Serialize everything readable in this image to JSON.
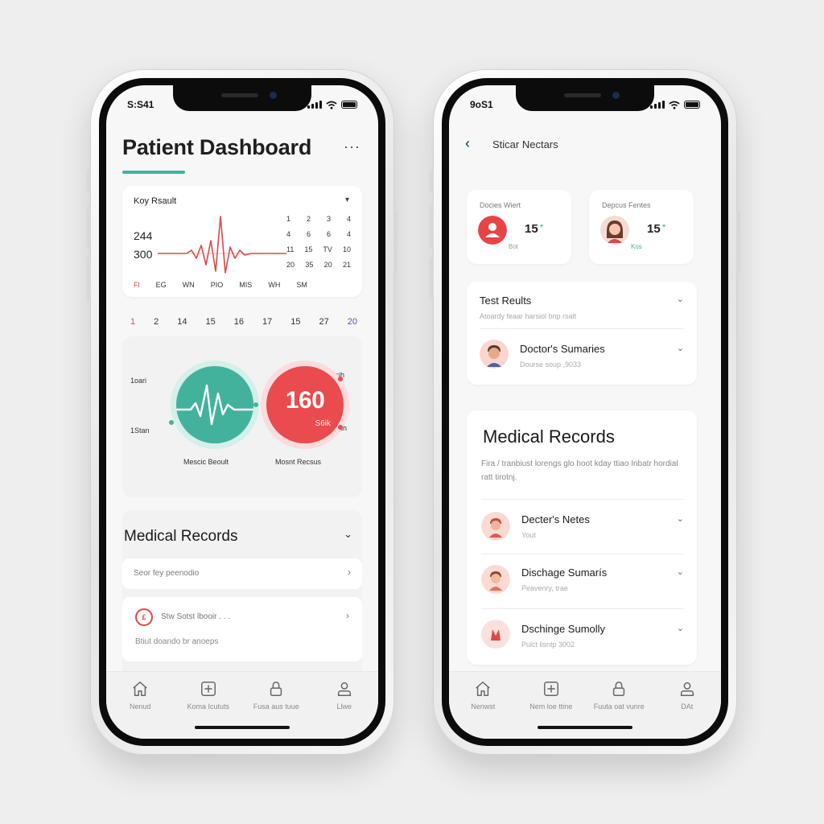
{
  "left_phone": {
    "status_time": "S:S41",
    "title": "Patient Dashboard",
    "more_label": "···",
    "vitals": {
      "label": "Koy Rsault",
      "caret": "▾",
      "value_top": "244",
      "value_bottom": "300",
      "mini_calendar": [
        [
          "1",
          "2",
          "3",
          "4"
        ],
        [
          "4",
          "6",
          "6",
          "4"
        ],
        [
          "11",
          "15",
          "TV",
          "10"
        ],
        [
          "20",
          "35",
          "20",
          "21"
        ]
      ],
      "weekdays": [
        "Fl",
        "EG",
        "WN",
        "PIO",
        "MIS",
        "WH",
        "SM"
      ]
    },
    "dates": [
      "1",
      "2",
      "14",
      "15",
      "16",
      "17",
      "15",
      "27",
      "20"
    ],
    "gauges": {
      "left_top_label": "1oari",
      "left_bottom_label": "1Stan",
      "right_top_label": "Stsih",
      "right_bottom_label": "Otsh",
      "teal_caption": "Mescic Beoult",
      "red_value": "160",
      "red_sub": "S6ik",
      "red_caption": "Mosnt Recsus",
      "teal_color": "#42b29d",
      "red_color": "#ea4b4e"
    },
    "records": {
      "title": "Medical Records",
      "chevron": "⌄",
      "search_placeholder": "Seor fey peenodio",
      "search_arrow": "›",
      "item_icon": "£",
      "item_title": "Stw Sotst lbooir . . .",
      "item_arrow": "›",
      "item_sub": "Btiut doando br anoeps"
    },
    "tabs": [
      {
        "label": "Nenud",
        "icon": "home-icon"
      },
      {
        "label": "Koma Icututs",
        "icon": "medical-kit-icon"
      },
      {
        "label": "Fusa aus tuue",
        "icon": "lock-icon"
      },
      {
        "label": "Llwe",
        "icon": "user-icon"
      }
    ]
  },
  "right_phone": {
    "status_time": "9oS1",
    "back_icon": "‹",
    "title": "Sticar Nectars",
    "doctor_cards": [
      {
        "label": "Docies Wiert",
        "value": "15",
        "mark": "+",
        "sub": "Bot",
        "avatar_color": "#e84346"
      },
      {
        "label": "Depcus Fentes",
        "value": "15",
        "mark": "+",
        "sub": "Kos",
        "avatar_color": "#e8c8b8"
      }
    ],
    "test_results": {
      "title": "Test Reults",
      "chevron": "⌄",
      "subtitle": "Atoardy feaar harsiol bnp rsalt",
      "row_title": "Doctor's Sumaries",
      "row_sub": "Dourse soup ,9033"
    },
    "medical_records": {
      "title": "Medical Records",
      "description": "Fira / tranbiust lorengs glo hoot kday ttiao Inbatr hordial ratt tirotnj.",
      "items": [
        {
          "title": "Decter's Netes",
          "sub": "Yout"
        },
        {
          "title": "Dischage Sumarís",
          "sub": "Peavenry, trae"
        },
        {
          "title": "Dschinge Sumolly",
          "sub": "Pulct lisntp 3002"
        }
      ],
      "chevron": "⌄"
    },
    "tabs": [
      {
        "label": "Nenwst",
        "icon": "home-icon"
      },
      {
        "label": "Nem loe ttine",
        "icon": "medical-kit-icon"
      },
      {
        "label": "Fuuta oat vunre",
        "icon": "lock-icon"
      },
      {
        "label": "DAt",
        "icon": "user-icon"
      }
    ]
  }
}
